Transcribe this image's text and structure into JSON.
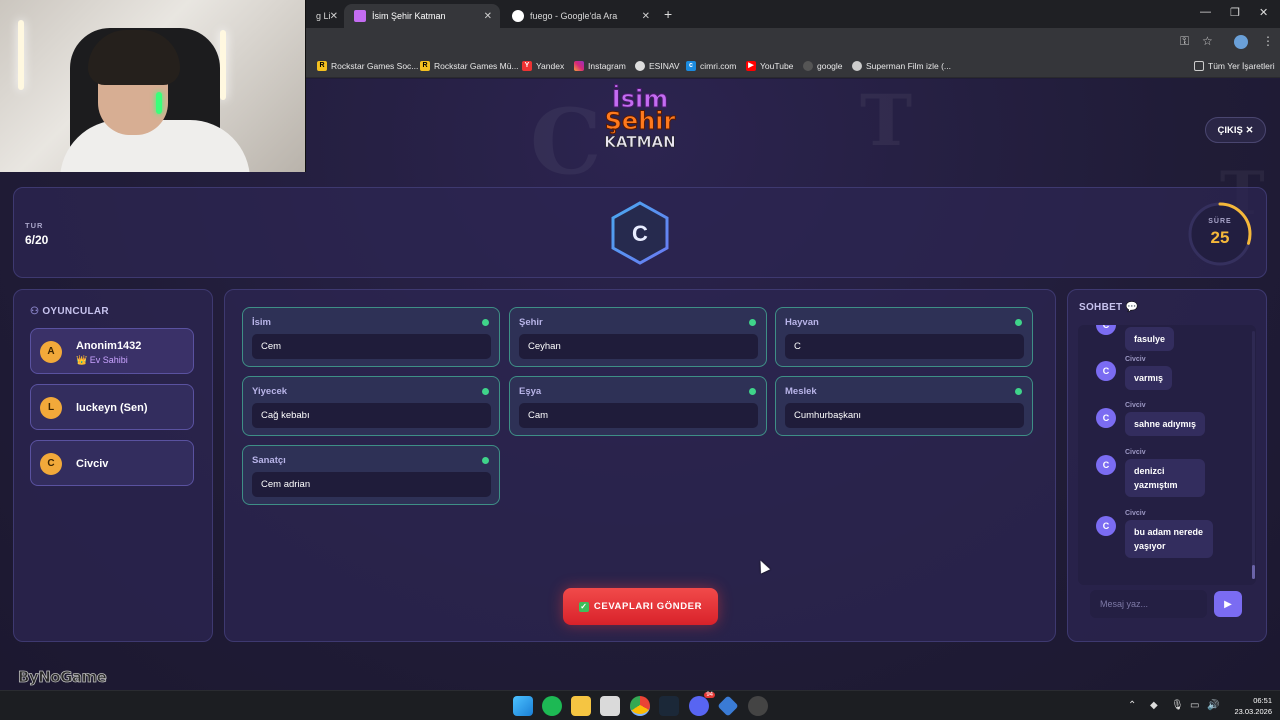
{
  "browser": {
    "tabs": [
      {
        "title": "g Li",
        "active": false
      },
      {
        "title": "İsim Şehir Katman",
        "active": true
      },
      {
        "title": "fuego - Google'da Ara",
        "active": false
      }
    ],
    "bookmarks": [
      "Rockstar Games Soc...",
      "Rockstar Games Mü...",
      "Yandex",
      "Instagram",
      "ESINAV",
      "cimri.com",
      "YouTube",
      "google",
      "Superman Film izle (..."
    ],
    "all_bookmarks": "Tüm Yer İşaretleri"
  },
  "game": {
    "logo": {
      "line1": "İsim",
      "line2": "Şehir",
      "line3": "KATMAN"
    },
    "exit_label": "ÇIKIŞ ✕",
    "round": {
      "label": "TUR",
      "value": "6/20"
    },
    "letter": "C",
    "timer": {
      "label": "SÜRE",
      "value": "25",
      "remaining_fraction": 0.3
    },
    "players_title": "OYUNCULAR",
    "players": [
      {
        "initial": "A",
        "name": "Anonim1432",
        "sub": "👑 Ev Sahibi"
      },
      {
        "initial": "L",
        "name": "luckeyn (Sen)",
        "sub": ""
      },
      {
        "initial": "C",
        "name": "Civciv",
        "sub": ""
      }
    ],
    "fields": [
      {
        "label": "İsim",
        "value": "Cem"
      },
      {
        "label": "Şehir",
        "value": "Ceyhan"
      },
      {
        "label": "Hayvan",
        "value": "C"
      },
      {
        "label": "Yiyecek",
        "value": "Cağ kebabı"
      },
      {
        "label": "Eşya",
        "value": "Cam"
      },
      {
        "label": "Meslek",
        "value": "Cumhurbaşkanı"
      },
      {
        "label": "Sanatçı",
        "value": "Cem adrian"
      }
    ],
    "submit_label": "CEVAPLARI GÖNDER",
    "chat_title": "SOHBET 💬",
    "chat": [
      {
        "initial": "C",
        "name": "",
        "text": "fasulye"
      },
      {
        "initial": "C",
        "name": "Civciv",
        "text": "varmış"
      },
      {
        "initial": "C",
        "name": "Civciv",
        "text": "sahne adıymış"
      },
      {
        "initial": "C",
        "name": "Civciv",
        "text": "denizci yazmıştım"
      },
      {
        "initial": "C",
        "name": "Civciv",
        "text": "bu adam nerede yaşıyor"
      }
    ],
    "chat_placeholder": "Mesaj yaz...",
    "watermark": "ByNoGame"
  },
  "taskbar": {
    "time": "06:51",
    "date": "23.03.2026",
    "discord_badge": "94"
  },
  "colors": {
    "accent_purple": "#7b6cf2",
    "host_orange": "#f2a93a",
    "submit_red": "#e3303a",
    "status_green": "#3fd48a",
    "timer_gold": "#f5b83a"
  }
}
